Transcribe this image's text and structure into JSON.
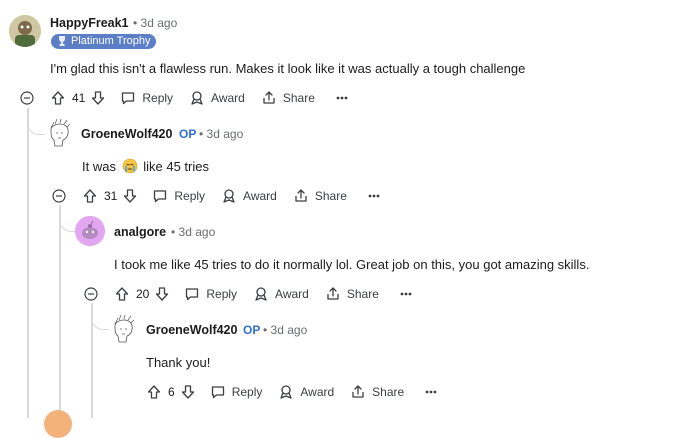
{
  "comments": [
    {
      "username": "HappyFreak1",
      "op": "",
      "time": "3d ago",
      "flair": "Platinum Trophy",
      "text": "I'm glad this isn't a flawless run. Makes it look like it was actually a tough challenge",
      "votes": "41",
      "reply_label": "Reply",
      "award_label": "Award",
      "share_label": "Share"
    },
    {
      "username": "GroeneWolf420",
      "op": "OP",
      "time": "3d ago",
      "text_before": "It was",
      "text_after": "like 45 tries",
      "votes": "31",
      "reply_label": "Reply",
      "award_label": "Award",
      "share_label": "Share"
    },
    {
      "username": "analgore",
      "op": "",
      "time": "3d ago",
      "text": "I took me like 45 tries to do it normally lol. Great job on this, you got amazing skills.",
      "votes": "20",
      "reply_label": "Reply",
      "award_label": "Award",
      "share_label": "Share"
    },
    {
      "username": "GroeneWolf420",
      "op": "OP",
      "time": "3d ago",
      "text": "Thank you!",
      "votes": "6",
      "reply_label": "Reply",
      "award_label": "Award",
      "share_label": "Share"
    }
  ],
  "colors": {
    "op": "#2f6fd8",
    "flair_bg": "#5b7ec7",
    "thread_line": "#d7dadc",
    "meta": "#6a6d70"
  },
  "icons": [
    "collapse-icon",
    "upvote-icon",
    "downvote-icon",
    "reply-icon",
    "award-icon",
    "share-icon",
    "more-icon",
    "trophy-icon",
    "crying-emoji-icon"
  ]
}
